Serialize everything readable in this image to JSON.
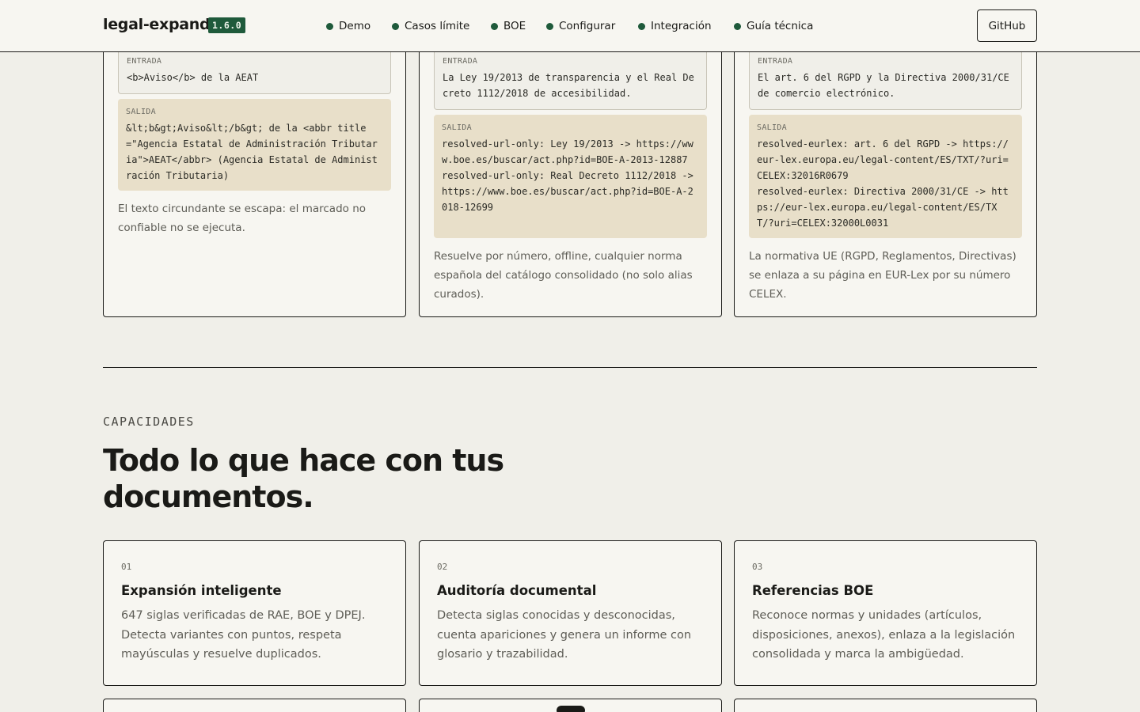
{
  "header": {
    "brand": "legal-expand",
    "version": "1.6.0",
    "nav": [
      "Demo",
      "Casos límite",
      "BOE",
      "Configurar",
      "Integración",
      "Guía técnica"
    ],
    "github_label": "GitHub"
  },
  "examples": [
    {
      "input_label": "ENTRADA",
      "input": "<b>Aviso</b> de la AEAT",
      "output_label": "SALIDA",
      "output": "&lt;b&gt;Aviso&lt;/b&gt; de la <abbr title=\"Agencia Estatal de Administración Tributaria\">AEAT</abbr> (Agencia Estatal de Administración Tributaria)",
      "description": "El texto circundante se escapa: el marcado no confiable no se ejecuta."
    },
    {
      "input_label": "ENTRADA",
      "input": "La Ley 19/2013 de transparencia y el Real Decreto 1112/2018 de accesibilidad.",
      "output_label": "SALIDA",
      "output": "resolved-url-only: Ley 19/2013 -> https://www.boe.es/buscar/act.php?id=BOE-A-2013-12887\nresolved-url-only: Real Decreto 1112/2018 -> https://www.boe.es/buscar/act.php?id=BOE-A-2018-12699",
      "description": "Resuelve por número, offline, cualquier norma española del catálogo consolidado (no solo alias curados)."
    },
    {
      "input_label": "ENTRADA",
      "input": "El art. 6 del RGPD y la Directiva 2000/31/CE de comercio electrónico.",
      "output_label": "SALIDA",
      "output": "resolved-eurlex: art. 6 del RGPD -> https://eur-lex.europa.eu/legal-content/ES/TXT/?uri=CELEX:32016R0679\nresolved-eurlex: Directiva 2000/31/CE -> https://eur-lex.europa.eu/legal-content/ES/TXT/?uri=CELEX:32000L0031",
      "description": "La normativa UE (RGPD, Reglamentos, Directivas) se enlaza a su página en EUR-Lex por su número CELEX."
    }
  ],
  "capabilities": {
    "eyebrow": "CAPACIDADES",
    "title": "Todo lo que hace con tus documentos.",
    "features": [
      {
        "number": "01",
        "title": "Expansión inteligente",
        "text": "647 siglas verificadas de RAE, BOE y DPEJ. Detecta variantes con puntos, respeta mayúsculas y resuelve duplicados."
      },
      {
        "number": "02",
        "title": "Auditoría documental",
        "text": "Detecta siglas conocidas y desconocidas, cuenta apariciones y genera un informe con glosario y trazabilidad."
      },
      {
        "number": "03",
        "title": "Referencias BOE",
        "text": "Reconoce normas y unidades (artículos, disposiciones, anexos), enlaza a la legislación consolidada y marca la ambigüedad."
      }
    ]
  },
  "colors": {
    "background": "#f0efe9",
    "card": "#f7f6f1",
    "accent": "#1f5a3b",
    "output_bg": "#e8dfc9",
    "ink": "#1a1a17"
  }
}
